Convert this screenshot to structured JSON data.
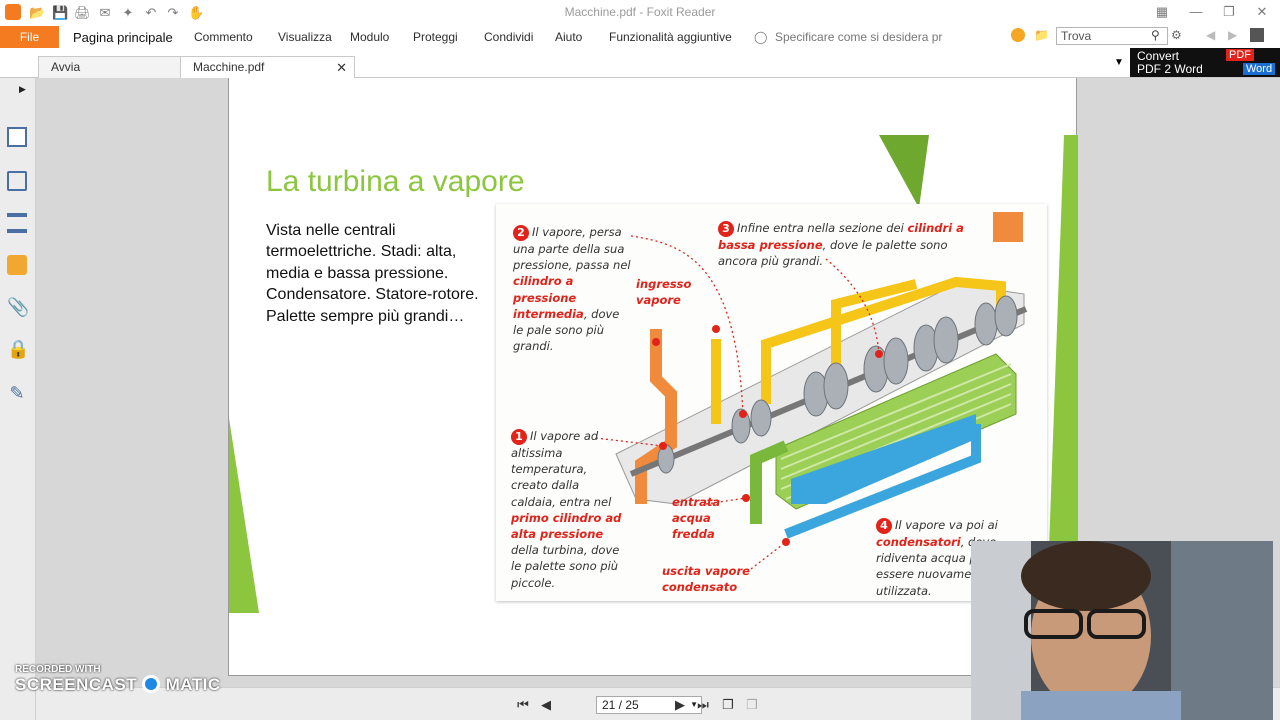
{
  "window": {
    "title": "Macchine.pdf - Foxit Reader"
  },
  "ribbon": {
    "file_label": "File",
    "menu": [
      "Pagina principale",
      "Commento",
      "Visualizza",
      "Modulo",
      "Proteggi",
      "Condividi",
      "Aiuto",
      "Funzionalità aggiuntive"
    ],
    "tell_me": "Specificare come si desidera pr",
    "search_placeholder": "Trova"
  },
  "tabs": [
    {
      "label": "Avvia"
    },
    {
      "label": "Macchine.pdf"
    }
  ],
  "convert": {
    "line1": "Convert",
    "line2": "PDF 2 Word",
    "badge_pdf": "PDF",
    "badge_word": "Word"
  },
  "slide": {
    "title": "La turbina a vapore",
    "body": "Vista nelle centrali termoelettriche. Stadi: alta, media e bassa pressione. Condensatore. Statore-rotore. Palette sempre più grandi…"
  },
  "diagram": {
    "ann2": {
      "num": "2",
      "pre": "Il vapore, persa una parte della sua pressione, passa nel ",
      "red": "cilindro a pressione intermedia",
      "post": ", dove le pale sono più grandi."
    },
    "ann3": {
      "num": "3",
      "pre": "Infine entra nella sezione dei ",
      "red": "cilindri a bassa pressione",
      "post": ", dove le palette sono ancora più grandi."
    },
    "ann1": {
      "num": "1",
      "pre": "Il vapore ad altissima temperatura, creato dalla caldaia, entra nel ",
      "red": "primo cilindro ad alta pressione",
      "post": " della turbina, dove le palette sono più piccole."
    },
    "ann4": {
      "num": "4",
      "pre": "Il vapore va poi ai ",
      "red": "condensatori",
      "post": ", dove ridiventa acqua per essere nuovamente utilizzata."
    },
    "ingresso": "ingresso vapore",
    "entrata": "entrata acqua fredda",
    "uscita": "uscita vapore condensato"
  },
  "nav": {
    "page": "21 / 25"
  },
  "watermark": {
    "line1": "RECORDED WITH",
    "line2": "SCREENCAST",
    "line3": "MATIC"
  },
  "colors": {
    "accent": "#f47b20",
    "slide_green": "#8cc63f",
    "red": "#e2231a"
  }
}
